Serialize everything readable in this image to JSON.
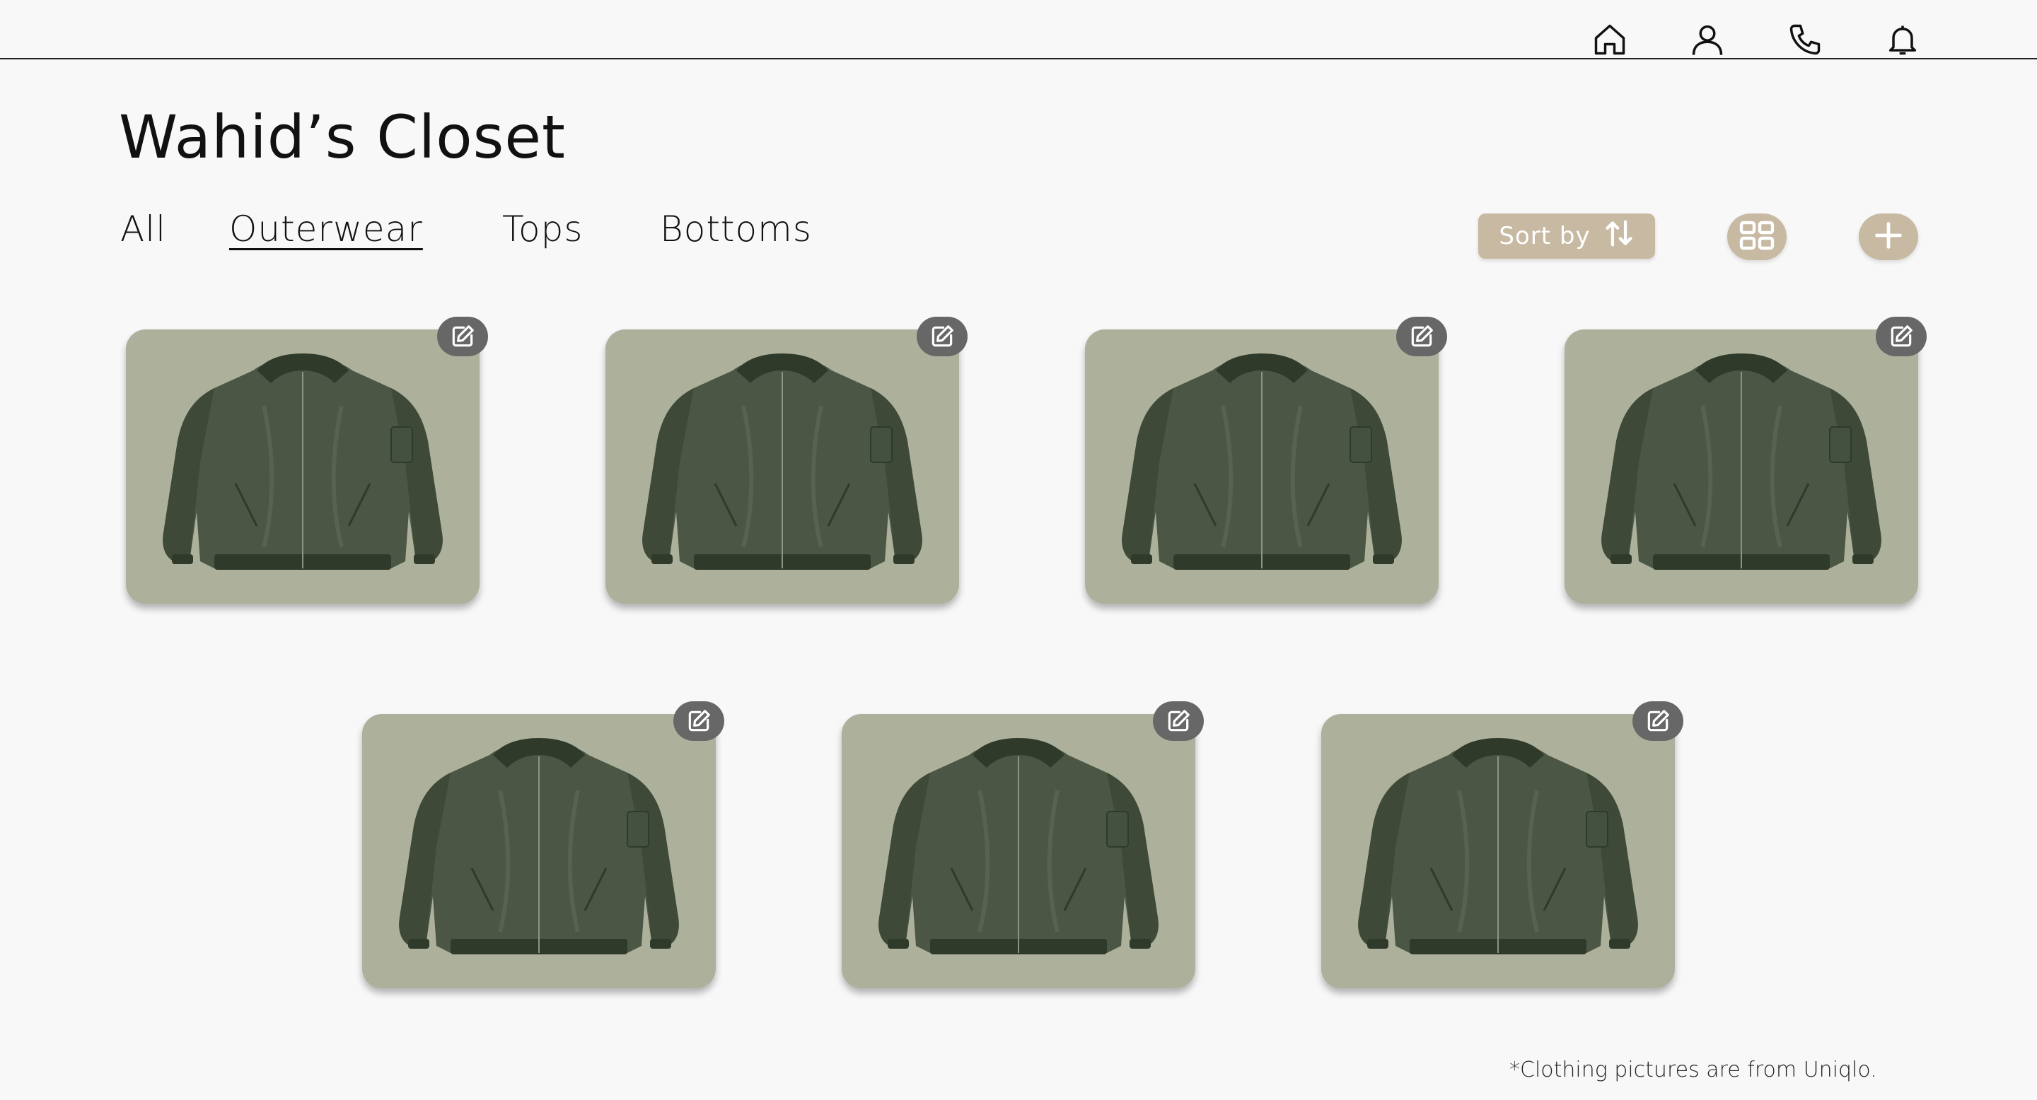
{
  "header": {
    "icons": [
      "home-icon",
      "user-icon",
      "phone-icon",
      "bell-icon"
    ]
  },
  "page": {
    "title": "Wahid’s Closet"
  },
  "tabs": [
    {
      "label": "All",
      "active": false
    },
    {
      "label": "Outerwear",
      "active": true
    },
    {
      "label": "Tops",
      "active": false
    },
    {
      "label": "Bottoms",
      "active": false
    }
  ],
  "toolbar": {
    "sort_label": "Sort by",
    "sort_icon": "sort-arrows-icon",
    "grid_icon": "grid-view-icon",
    "add_icon": "plus-icon"
  },
  "items": [
    {
      "image": "green-bomber-jacket",
      "edit_icon": "edit-icon"
    },
    {
      "image": "green-bomber-jacket",
      "edit_icon": "edit-icon"
    },
    {
      "image": "green-bomber-jacket",
      "edit_icon": "edit-icon"
    },
    {
      "image": "green-bomber-jacket",
      "edit_icon": "edit-icon"
    },
    {
      "image": "green-bomber-jacket",
      "edit_icon": "edit-icon"
    },
    {
      "image": "green-bomber-jacket",
      "edit_icon": "edit-icon"
    },
    {
      "image": "green-bomber-jacket",
      "edit_icon": "edit-icon"
    }
  ],
  "footnote": "*Clothing pictures are from Uniqlo.",
  "colors": {
    "background": "#f8f8f8",
    "accent": "#c7b9a2",
    "card": "#adb19c",
    "edit_button": "#676767",
    "jacket": "#4b5744"
  }
}
